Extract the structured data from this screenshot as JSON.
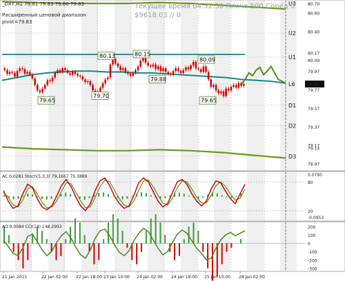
{
  "main_panel": {
    "header": "_DXY,H1  79.81 79.83 79.80 79.83",
    "indicator_line1": "Расширенный ценовой диапазон",
    "indicator_line2": "pivot=79.83",
    "watermark_line1": "Текущее время 04:52:30 Плечо 500 Спред 0",
    "watermark_line2": "$9618.03   // 0"
  },
  "stoch_panel": {
    "header": "AC 0.0281   Stoch(5,3,3) 79.1667 75.3889"
  },
  "ao_panel": {
    "header": "AO 0.0084   CCI(14) 148.2993"
  },
  "colors": {
    "price_up": "#d40000",
    "price_down": "#d40000",
    "forecast": "#5a8a1a",
    "pivot_teal": "#0e8a8a",
    "outer_band": "#6a9a14",
    "stoch_main": "#d40000",
    "stoch_signal": "#4a9a1a",
    "ac_bar": "#3a9a3a",
    "ao_bar": "#d40000",
    "cci": "#4a8a1a"
  },
  "chart_data": [
    {
      "type": "line",
      "title": "_DXY,H1",
      "description_series": "price candles with pivot levels",
      "x_tick_labels": [
        "21 Jan 2013",
        "22 Jan 02:00",
        "22 Jan 18:00",
        "23 Jan 10:00",
        "24 Jan 02:00",
        "24 Jan 18:00",
        "25 Jan 10:00",
        "28 Jan 02:00"
      ],
      "y_tick_labels": [
        "80.70",
        "80.60",
        "80.40",
        "80.17",
        "80.09",
        "79.97",
        "79.83",
        "79.77",
        "79.57",
        "79.37",
        "79.17",
        "79.14",
        "78.97"
      ],
      "ylim": [
        78.9,
        80.73
      ],
      "pivot_levels": [
        {
          "name": "U3",
          "value": 80.7
        },
        {
          "name": "U2",
          "value": 80.38
        },
        {
          "name": "U1",
          "value": 80.12
        },
        {
          "name": "L6",
          "value": 79.83
        },
        {
          "name": "D1",
          "value": 79.6
        },
        {
          "name": "D2",
          "value": 79.38
        },
        {
          "name": "D3",
          "value": 79.05
        }
      ],
      "annotations": [
        {
          "text": "79.65",
          "value": 79.65
        },
        {
          "text": "79.70",
          "value": 79.7
        },
        {
          "text": "80.13",
          "value": 80.13
        },
        {
          "text": "80.15",
          "value": 80.15
        },
        {
          "text": "79.88",
          "value": 79.88
        },
        {
          "text": "80.09",
          "value": 80.09
        },
        {
          "text": "79.65",
          "value": 79.65
        }
      ],
      "current_price": "79.83",
      "close_series": [
        79.98,
        79.94,
        79.96,
        79.95,
        79.91,
        79.97,
        80.0,
        79.99,
        79.94,
        79.96,
        79.93,
        79.89,
        79.82,
        79.76,
        79.74,
        79.78,
        79.82,
        79.87,
        79.86,
        79.9,
        79.95,
        79.98,
        79.96,
        80.0,
        79.98,
        79.95,
        79.93,
        79.96,
        79.94,
        79.92,
        79.91,
        79.88,
        79.85,
        79.86,
        79.82,
        79.76,
        79.72,
        79.75,
        79.79,
        79.84,
        79.88,
        79.9,
        80.04,
        80.1,
        80.05,
        80.02,
        79.98,
        80.0,
        79.96,
        79.94,
        79.92,
        79.95,
        79.98,
        80.02,
        80.08,
        80.12,
        80.06,
        80.03,
        80.02,
        80.04,
        79.99,
        80.02,
        79.97,
        80.0,
        79.96,
        79.94,
        79.93,
        79.97,
        80.0,
        79.97,
        79.95,
        79.98,
        80.01,
        79.99,
        80.03,
        80.07,
        80.0,
        79.99,
        79.96,
        80.02,
        79.96,
        79.88,
        79.8,
        79.82,
        79.76,
        79.73,
        79.75,
        79.7,
        79.78,
        79.76,
        79.8,
        79.82,
        79.79,
        79.84,
        79.81,
        79.83
      ],
      "forecast_series": [
        79.83,
        79.88,
        79.95,
        79.92,
        79.98,
        80.01,
        79.93,
        79.97,
        80.02,
        79.95,
        79.88,
        79.86,
        79.84
      ],
      "pivot_line_series": [
        79.87,
        79.9,
        79.93,
        79.95,
        79.96,
        79.97,
        79.97,
        79.96,
        79.96,
        79.95,
        79.95,
        79.94,
        79.93,
        79.92,
        79.91,
        79.9,
        79.88,
        79.87,
        79.86,
        79.84
      ],
      "upper_band": [
        80.72,
        80.71,
        80.7,
        80.7,
        80.7,
        80.71,
        80.7,
        80.68,
        80.66,
        80.64
      ],
      "lower_band": [
        79.15,
        79.13,
        79.12,
        79.11,
        79.11,
        79.12,
        79.11,
        79.09,
        79.06,
        79.03
      ]
    },
    {
      "type": "line",
      "title": "AC / Stoch(5,3,3)",
      "y_tick_labels": [
        "0.0795",
        "80",
        "20",
        "-0.0953"
      ],
      "ylim": [
        -0.0953,
        0.0795
      ],
      "stoch_levels": [
        80,
        20
      ],
      "stoch_main": [
        62,
        40,
        25,
        30,
        55,
        75,
        68,
        45,
        28,
        22,
        30,
        50,
        72,
        85,
        70,
        48,
        30,
        20,
        35,
        62,
        82,
        88,
        72,
        50,
        35,
        25,
        30,
        52,
        78,
        88,
        80,
        60,
        40,
        28,
        35,
        58,
        80,
        85,
        75,
        55,
        40,
        30,
        40,
        65,
        82,
        78,
        60,
        45,
        35,
        55,
        75
      ],
      "stoch_signal": [
        58,
        48,
        32,
        28,
        42,
        65,
        70,
        55,
        38,
        26,
        28,
        40,
        60,
        78,
        76,
        58,
        40,
        26,
        28,
        48,
        70,
        84,
        80,
        62,
        45,
        32,
        28,
        40,
        62,
        82,
        84,
        70,
        52,
        36,
        32,
        46,
        68,
        82,
        80,
        65,
        48,
        36,
        36,
        52,
        72,
        80,
        70,
        55,
        42,
        46,
        65
      ]
    },
    {
      "type": "bar",
      "title": "AO / CCI(14)",
      "y_tick_labels": [
        "200",
        "100",
        "0",
        "-100",
        "-200",
        "-300"
      ],
      "ylim": [
        -330,
        250
      ],
      "cci": [
        40,
        -40,
        -120,
        -150,
        -60,
        80,
        110,
        20,
        -80,
        -150,
        -100,
        10,
        90,
        140,
        60,
        -50,
        -140,
        -180,
        -80,
        60,
        150,
        170,
        90,
        -20,
        -110,
        -150,
        -90,
        30,
        120,
        180,
        140,
        40,
        -60,
        -140,
        -100,
        10,
        110,
        160,
        120,
        30,
        -60,
        -120,
        -200,
        -180,
        -60,
        40,
        100,
        130,
        90,
        120,
        150
      ],
      "ao": [
        20,
        10,
        -10,
        -20,
        -30,
        -20,
        10,
        20,
        15,
        5,
        -10,
        -20,
        -15,
        5,
        20,
        30,
        25,
        10,
        -10,
        -25,
        -20,
        5,
        25,
        35,
        30,
        15,
        -5,
        -20,
        -25,
        -10,
        15,
        30,
        35,
        25,
        10,
        -10,
        -20,
        -15,
        5,
        20,
        25,
        15,
        -10,
        -30,
        -45,
        -40,
        -25,
        -10,
        -5,
        0,
        5
      ]
    }
  ]
}
